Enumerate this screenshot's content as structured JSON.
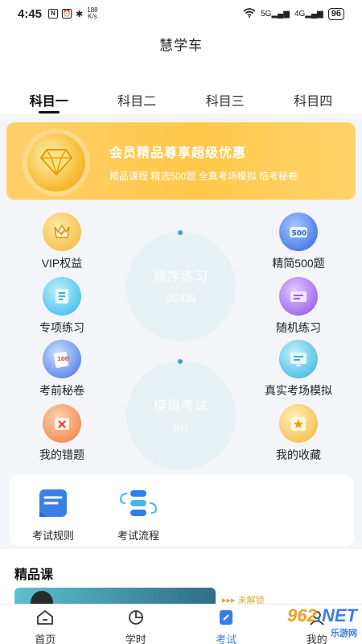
{
  "status_bar": {
    "time": "4:45",
    "speed_value": "188",
    "speed_unit": "K/s",
    "network1": "5G",
    "network2": "4G",
    "battery": "96"
  },
  "app": {
    "title": "慧学车"
  },
  "tabs": [
    {
      "label": "科目一",
      "active": true
    },
    {
      "label": "科目二",
      "active": false
    },
    {
      "label": "科目三",
      "active": false
    },
    {
      "label": "科目四",
      "active": false
    }
  ],
  "vip_banner": {
    "title": "会员精品尊享超级优惠",
    "subtitle": "精品课程  精选500题  全真考场模拟  临考秘卷"
  },
  "features": {
    "vip_rights": {
      "label": "VIP权益",
      "icon": "crown-icon"
    },
    "special_practice": {
      "label": "专项练习",
      "icon": "document-icon"
    },
    "exam_secret": {
      "label": "考前秘卷",
      "icon": "exam-paper-icon"
    },
    "wrong_questions": {
      "label": "我的错题",
      "icon": "wrong-box-icon"
    },
    "select_500": {
      "label": "精简500题",
      "icon": "500-badge-icon",
      "badge": "500"
    },
    "random_practice": {
      "label": "随机练习",
      "icon": "random-card-icon"
    },
    "real_exam": {
      "label": "真实考场模拟",
      "icon": "monitor-icon"
    },
    "favorites": {
      "label": "我的收藏",
      "icon": "star-box-icon"
    }
  },
  "sequential_practice": {
    "label": "顺序练习",
    "progress": "0/2439"
  },
  "mock_exam": {
    "label": "模拟考试",
    "score": "0分"
  },
  "quick_links": [
    {
      "label": "考试规则",
      "icon": "rules-icon"
    },
    {
      "label": "考试流程",
      "icon": "flow-icon"
    }
  ],
  "course_section": {
    "title": "精品课",
    "unlock_label": "未解锁"
  },
  "bottom_nav": [
    {
      "label": "首页",
      "icon": "home-icon",
      "active": false
    },
    {
      "label": "学时",
      "icon": "pie-chart-icon",
      "active": false
    },
    {
      "label": "考试",
      "icon": "exam-icon",
      "active": true
    },
    {
      "label": "我的",
      "icon": "user-icon",
      "active": false
    }
  ],
  "watermark": {
    "brand": "962",
    "suffix": ".NET",
    "sub": "乐游网"
  },
  "colors": {
    "accent_blue": "#3a7de8",
    "vip_gold": "#ffc84a",
    "green_circle": "#3cc7a6",
    "blue_circle": "#3d8fe8"
  }
}
